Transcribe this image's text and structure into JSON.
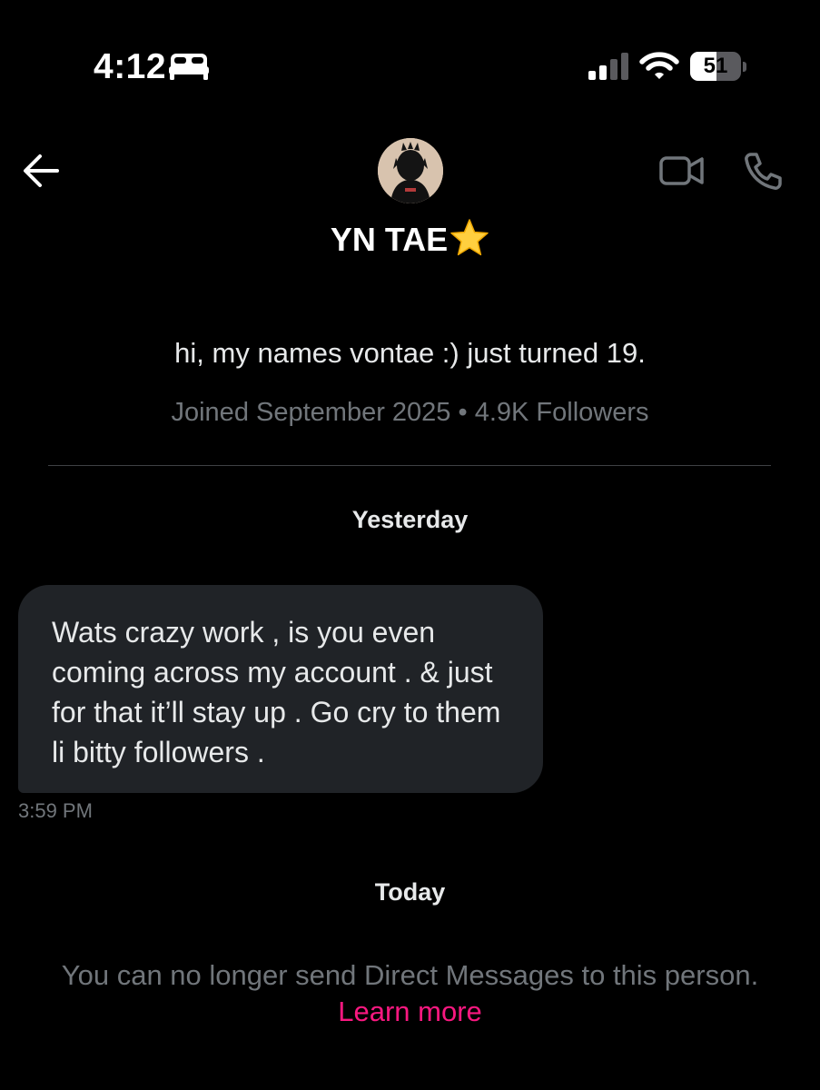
{
  "status_bar": {
    "time": "4:12",
    "battery_level": "51",
    "battery_fraction": 0.51,
    "icons": [
      "bed-icon",
      "signal-icon",
      "wifi-icon",
      "battery-icon"
    ]
  },
  "header": {
    "back_icon": "arrow-left-icon",
    "display_name": "YN TAE",
    "name_emoji": "star-icon",
    "actions": [
      "video-call-icon",
      "phone-call-icon"
    ]
  },
  "profile": {
    "bio": "hi, my names vontae :) just turned 19.",
    "meta": "Joined September 2025 • 4.9K Followers"
  },
  "conversation": {
    "groups": [
      {
        "day": "Yesterday",
        "messages": [
          {
            "text": "Wats crazy work , is you even coming across my account . & just for that it’ll stay up . Go cry to them li bitty followers .",
            "time": "3:59 PM"
          }
        ]
      },
      {
        "day": "Today",
        "notice": "You can no longer send Direct Messages to this person.",
        "link": "Learn more"
      }
    ]
  },
  "colors": {
    "background": "#000000",
    "bubble": "#202327",
    "secondary_text": "#71767b",
    "link": "#f91880"
  }
}
